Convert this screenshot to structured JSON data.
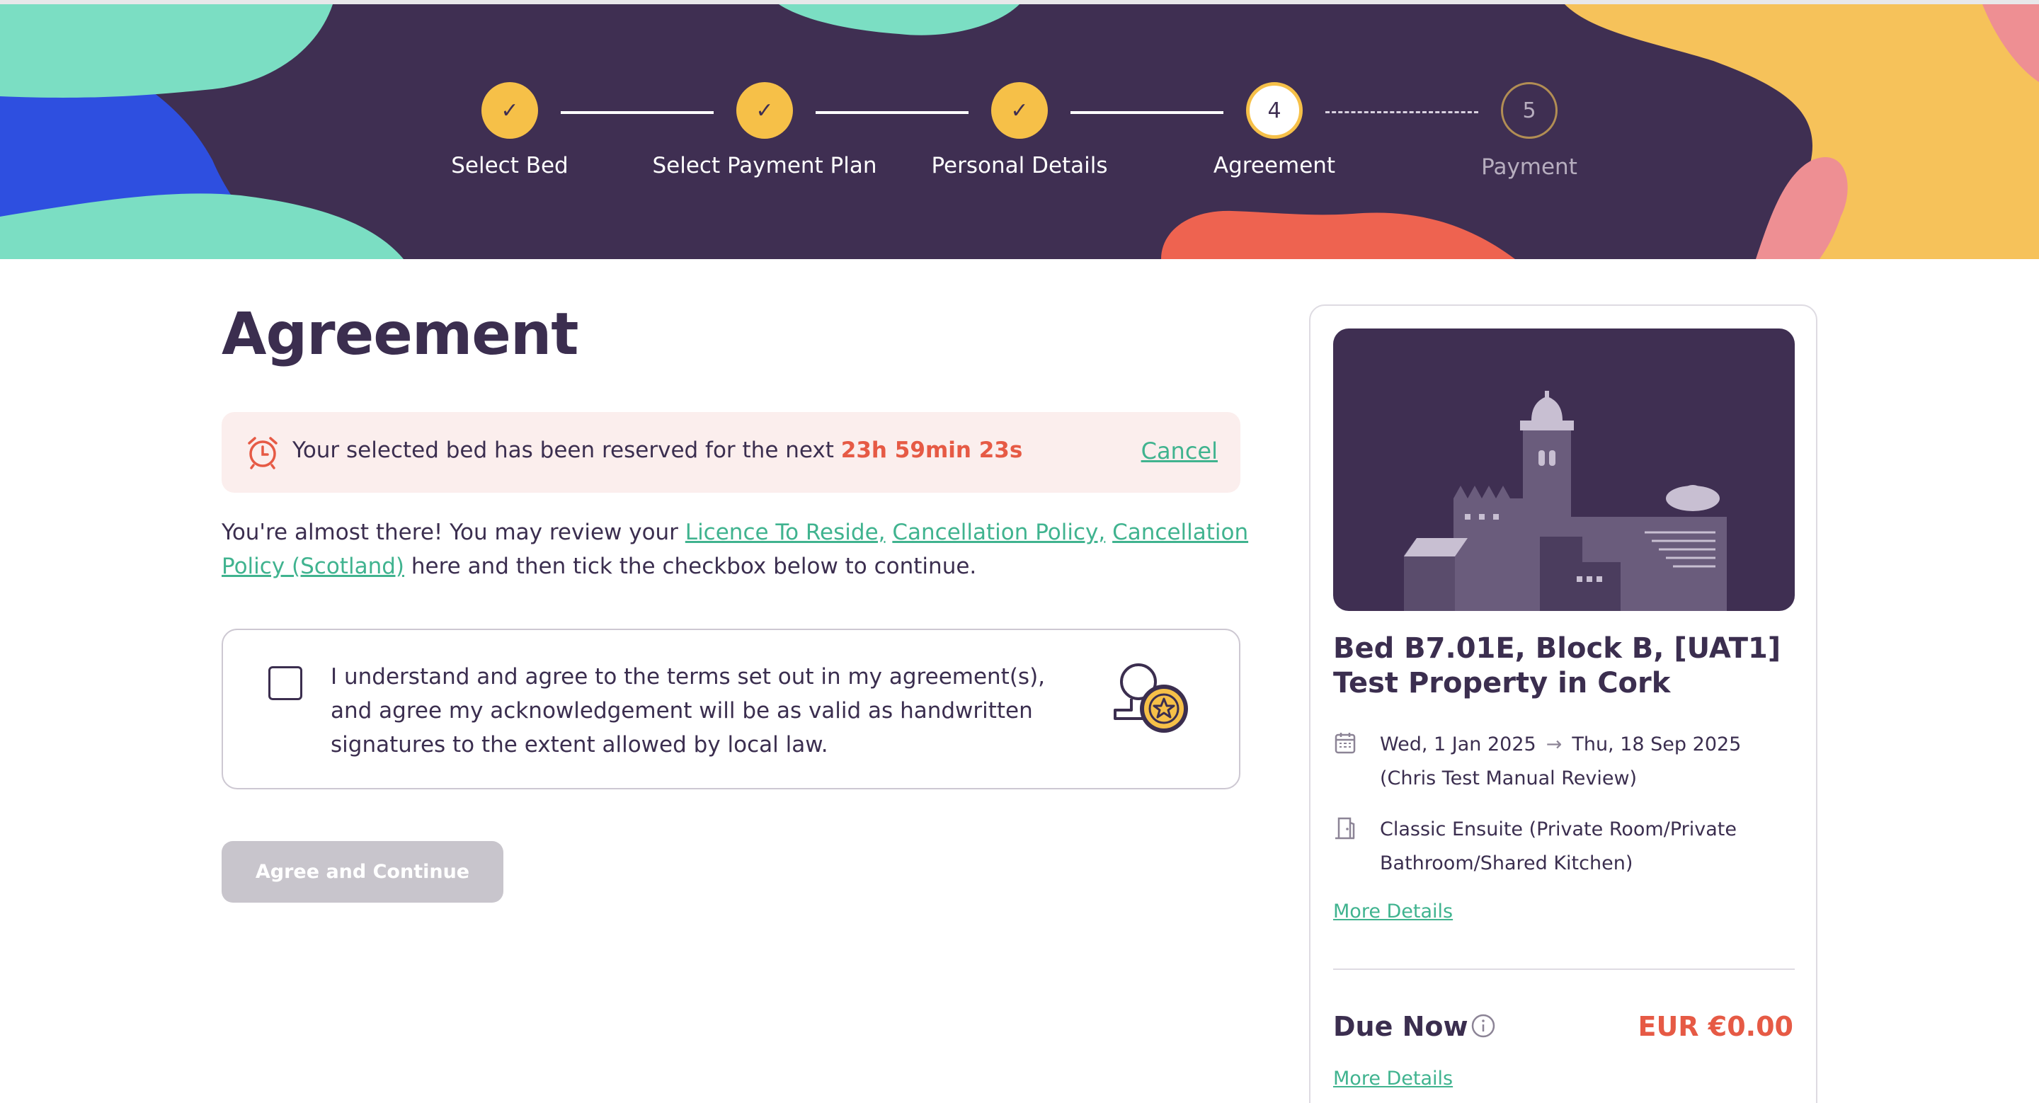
{
  "colors": {
    "banner_bg": "#3f2f52",
    "step_done": "#f6c048",
    "accent_link": "#40b38f",
    "timer_red": "#e65a45",
    "alert_bg": "#fbeeed",
    "disabled_button": "#c8c5cc"
  },
  "stepper": {
    "steps": [
      {
        "label": "Select Bed",
        "state": "done",
        "icon": "check-icon"
      },
      {
        "label": "Select Payment Plan",
        "state": "done",
        "icon": "check-icon"
      },
      {
        "label": "Personal Details",
        "state": "done",
        "icon": "check-icon"
      },
      {
        "label": "Agreement",
        "state": "current",
        "number": "4"
      },
      {
        "label": "Payment",
        "state": "future",
        "number": "5"
      }
    ]
  },
  "page": {
    "title": "Agreement"
  },
  "alert": {
    "icon": "alarm-clock-icon",
    "text": "Your selected bed has been reserved for the next ",
    "timer": "23h 59min 23s",
    "cancel_label": "Cancel"
  },
  "intro": {
    "text_before": "You're almost there! You may review your ",
    "links": [
      "Licence To Reside,",
      "Cancellation Policy,",
      "Cancellation Policy (Scotland)"
    ],
    "text_after": " here and then tick the checkbox below to continue."
  },
  "consent": {
    "checked": false,
    "text": "I understand and agree to the terms set out in my agreement(s), and agree my acknowledgement will be as valid as handwritten signatures to the extent allowed by local law.",
    "icon": "signature-stamp-icon"
  },
  "actions": {
    "agree_label": "Agree and Continue",
    "agree_disabled": true
  },
  "summary": {
    "image": "building-illustration",
    "property_name": "Bed B7.01E, Block B, [UAT1] Test Property in Cork",
    "dates": {
      "icon": "calendar-icon",
      "start": "Wed, 1 Jan 2025",
      "arrow": "→",
      "end": "Thu, 18 Sep 2025",
      "note": "(Chris Test Manual Review)"
    },
    "room": {
      "icon": "door-icon",
      "line1": "Classic Ensuite (Private Room/Private",
      "line2": "Bathroom/Shared Kitchen)"
    },
    "more_details_label": "More Details",
    "due_now_label": "Due Now",
    "due_info_icon": "info-icon",
    "due_amount": "EUR €0.00",
    "due_more_details_label": "More Details"
  }
}
